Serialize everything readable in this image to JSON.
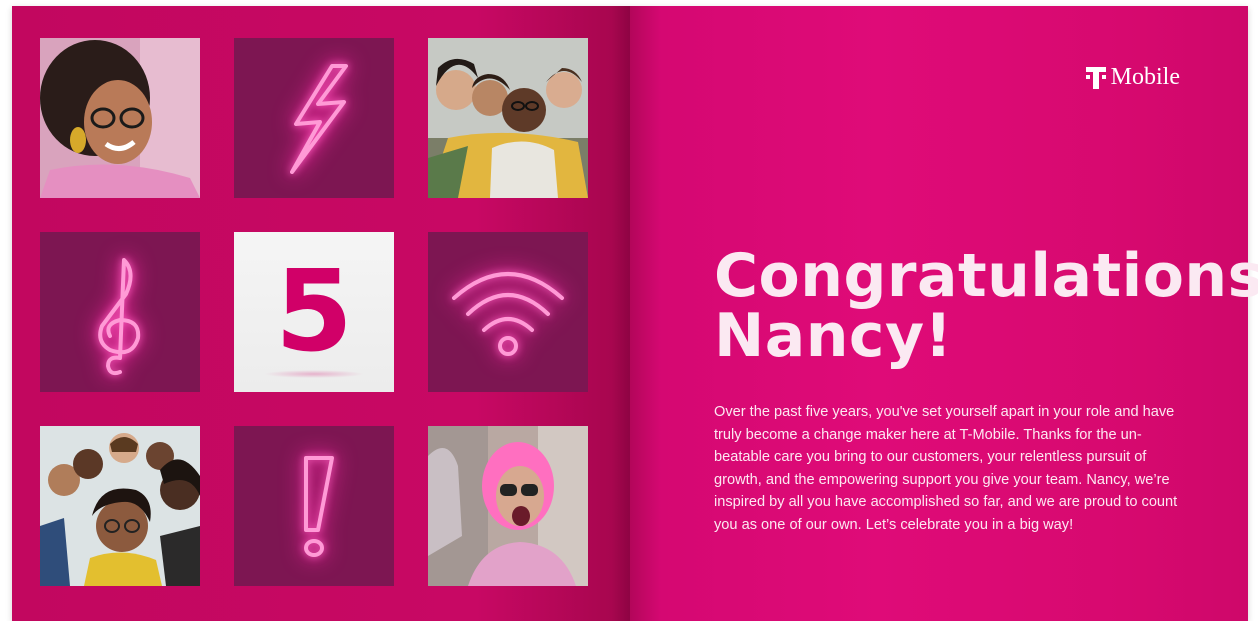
{
  "brand": {
    "logo_text": "T Mobile",
    "logo_mark": "T",
    "primary_color": "#e20074"
  },
  "hero_number": "5",
  "heading": {
    "line1": "Congratulations,",
    "line2": "Nancy!"
  },
  "message": "Over the past five years, you've set yourself apart in your role and have truly become a change maker here at T-Mobile. Thanks for the un-beatable care you bring to our customers, your relentless pursuit of growth, and the empowering support you give your team. Nancy, we’re inspired by all you have accomplished so far, and we are proud to count you as one of our own. Let’s celebrate you in a big way!",
  "grid_tiles": [
    {
      "kind": "photo",
      "subject": "smiling woman with glasses and gold earrings"
    },
    {
      "kind": "neon-icon",
      "icon": "lightning-bolt-icon"
    },
    {
      "kind": "photo",
      "subject": "group selfie of friends"
    },
    {
      "kind": "neon-icon",
      "icon": "treble-clef-icon"
    },
    {
      "kind": "number",
      "icon": "number-five"
    },
    {
      "kind": "neon-icon",
      "icon": "wifi-icon"
    },
    {
      "kind": "photo",
      "subject": "group of friends taking selfie"
    },
    {
      "kind": "neon-icon",
      "icon": "exclamation-icon"
    },
    {
      "kind": "photo",
      "subject": "woman with pink hair and sunglasses"
    }
  ]
}
